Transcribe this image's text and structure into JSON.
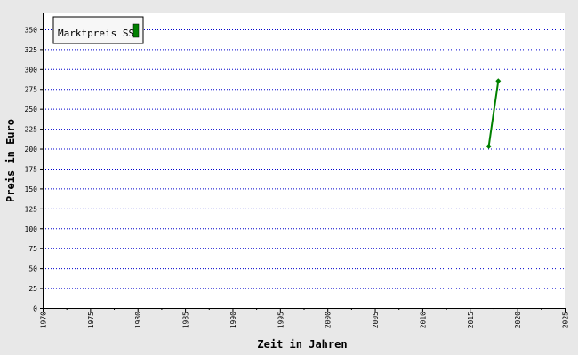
{
  "chart_data": {
    "type": "line",
    "xlabel": "Zeit in Jahren",
    "ylabel": "Preis in Euro",
    "xlim": [
      1970,
      2025
    ],
    "ylim": [
      0,
      370
    ],
    "x_ticks": [
      1970,
      1975,
      1980,
      1985,
      1990,
      1995,
      2000,
      2005,
      2010,
      2015,
      2020,
      2025
    ],
    "y_ticks": [
      0,
      25,
      50,
      75,
      100,
      125,
      150,
      175,
      200,
      225,
      250,
      275,
      300,
      325,
      350
    ],
    "grid": true,
    "legend_position": "top-left",
    "series": [
      {
        "name": "Marktpreis SS",
        "color": "#008000",
        "points": [
          {
            "x": 2017,
            "y": 203
          },
          {
            "x": 2018,
            "y": 285
          }
        ]
      }
    ]
  }
}
